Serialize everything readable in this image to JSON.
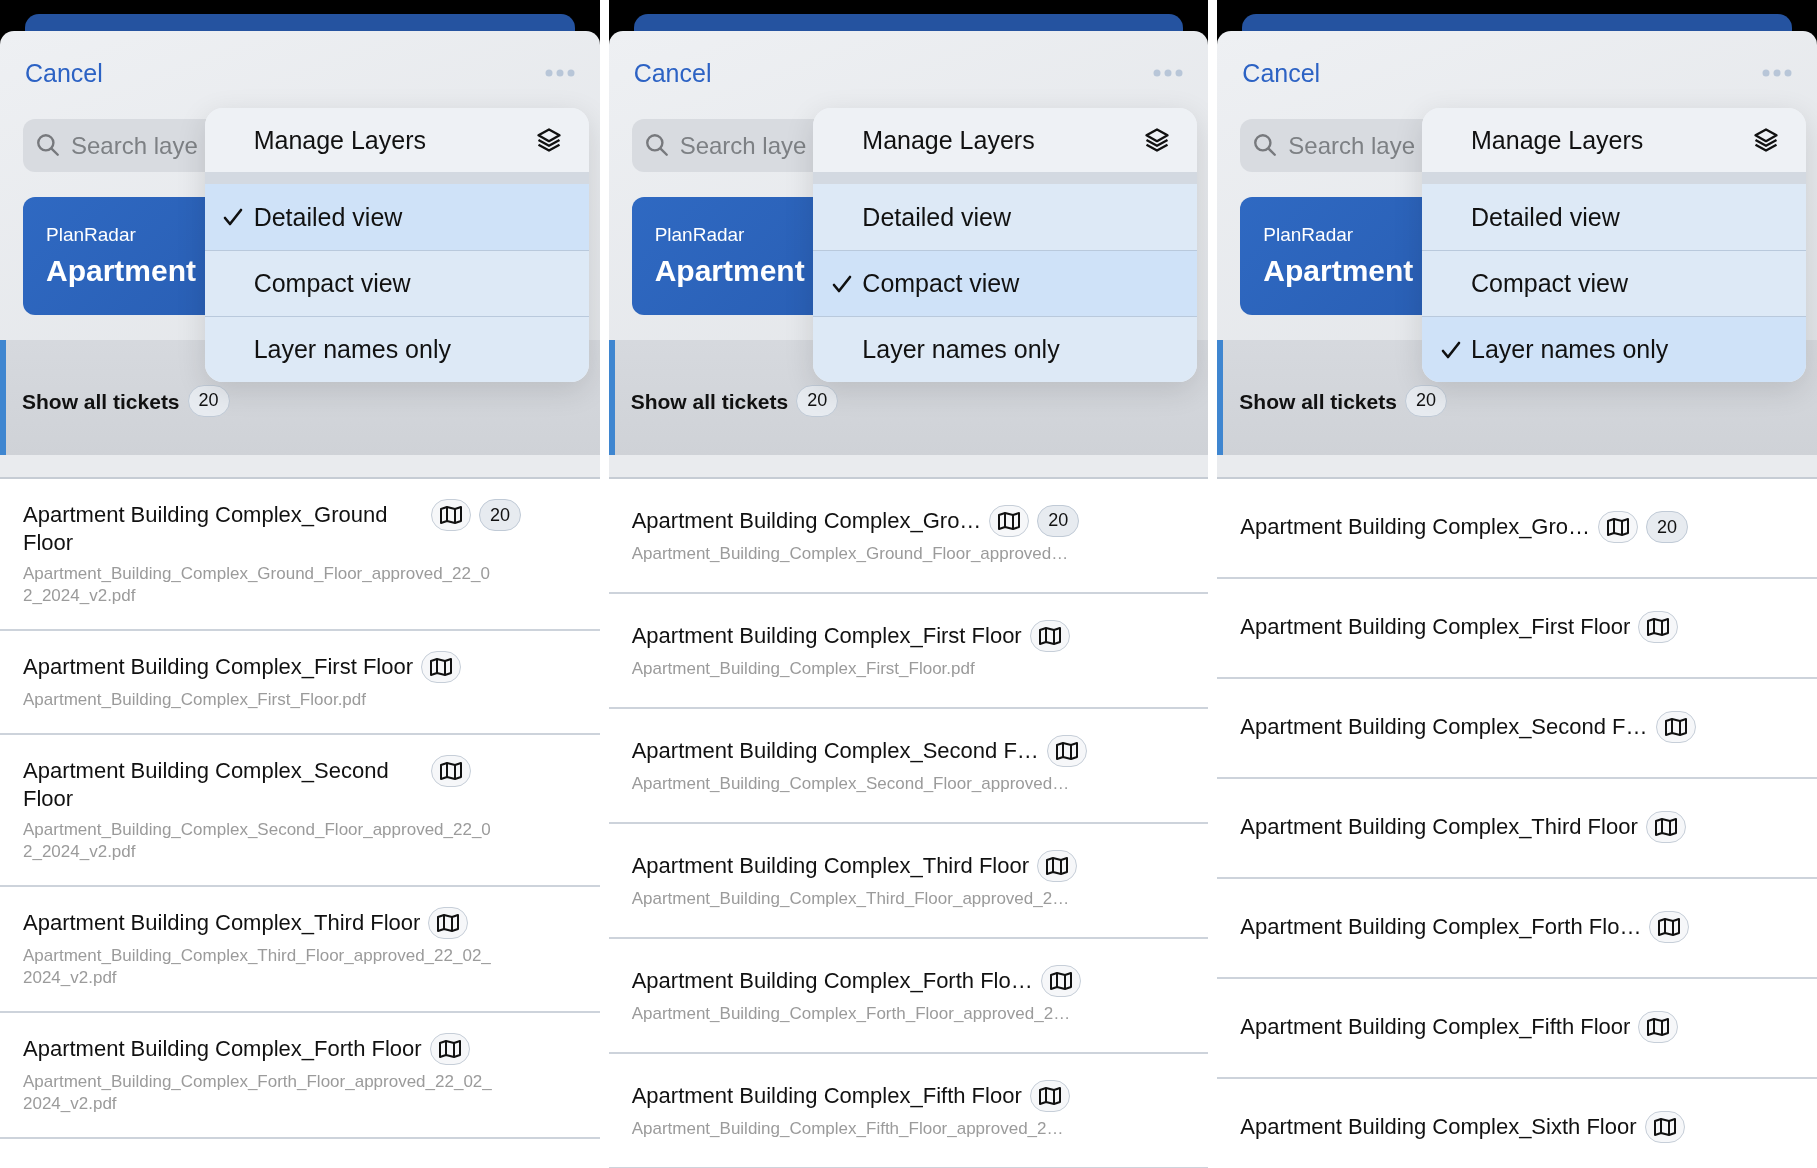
{
  "panels": [
    {
      "cancel": "Cancel",
      "search": {
        "placeholder": "Search laye"
      },
      "project": {
        "company": "PlanRadar",
        "name": "Apartment"
      },
      "tickets": {
        "label": "Show all tickets",
        "count": "20"
      },
      "menu": {
        "title": "Manage Layers",
        "options": [
          {
            "label": "Detailed view",
            "selected": true
          },
          {
            "label": "Compact view",
            "selected": false
          },
          {
            "label": "Layer names only",
            "selected": false
          }
        ]
      },
      "kind": "detailed",
      "layers": [
        {
          "title": "Apartment Building Complex_Ground Floor",
          "file": "Apartment_Building_Complex_Ground_Floor_approved_22_02_2024_v2.pdf",
          "count": "20"
        },
        {
          "title": "Apartment Building Complex_First Floor",
          "file": "Apartment_Building_Complex_First_Floor.pdf"
        },
        {
          "title": "Apartment Building Complex_Second Floor",
          "file": "Apartment_Building_Complex_Second_Floor_approved_22_02_2024_v2.pdf"
        },
        {
          "title": "Apartment Building Complex_Third Floor",
          "file": "Apartment_Building_Complex_Third_Floor_approved_22_02_2024_v2.pdf"
        },
        {
          "title": "Apartment Building Complex_Forth Floor",
          "file": "Apartment_Building_Complex_Forth_Floor_approved_22_02_2024_v2.pdf"
        }
      ]
    },
    {
      "cancel": "Cancel",
      "search": {
        "placeholder": "Search laye"
      },
      "project": {
        "company": "PlanRadar",
        "name": "Apartment"
      },
      "tickets": {
        "label": "Show all tickets",
        "count": "20"
      },
      "menu": {
        "title": "Manage Layers",
        "options": [
          {
            "label": "Detailed view",
            "selected": false
          },
          {
            "label": "Compact view",
            "selected": true
          },
          {
            "label": "Layer names only",
            "selected": false
          }
        ]
      },
      "kind": "compact",
      "layers": [
        {
          "title": "Apartment Building Complex_Gro…",
          "file": "Apartment_Building_Complex_Ground_Floor_approved…",
          "count": "20"
        },
        {
          "title": "Apartment Building Complex_First Floor",
          "file": "Apartment_Building_Complex_First_Floor.pdf"
        },
        {
          "title": "Apartment Building Complex_Second F…",
          "file": "Apartment_Building_Complex_Second_Floor_approved…"
        },
        {
          "title": "Apartment Building Complex_Third Floor",
          "file": "Apartment_Building_Complex_Third_Floor_approved_2…"
        },
        {
          "title": "Apartment Building Complex_Forth Flo…",
          "file": "Apartment_Building_Complex_Forth_Floor_approved_2…"
        },
        {
          "title": "Apartment Building Complex_Fifth Floor",
          "file": "Apartment_Building_Complex_Fifth_Floor_approved_2…"
        }
      ]
    },
    {
      "cancel": "Cancel",
      "search": {
        "placeholder": "Search laye"
      },
      "project": {
        "company": "PlanRadar",
        "name": "Apartment"
      },
      "tickets": {
        "label": "Show all tickets",
        "count": "20"
      },
      "menu": {
        "title": "Manage Layers",
        "options": [
          {
            "label": "Detailed view",
            "selected": false
          },
          {
            "label": "Compact view",
            "selected": false
          },
          {
            "label": "Layer names only",
            "selected": true
          }
        ]
      },
      "kind": "names",
      "layers": [
        {
          "title": "Apartment Building Complex_Gro…",
          "count": "20"
        },
        {
          "title": "Apartment Building Complex_First Floor"
        },
        {
          "title": "Apartment Building Complex_Second F…"
        },
        {
          "title": "Apartment Building Complex_Third Floor"
        },
        {
          "title": "Apartment Building Complex_Forth Flo…"
        },
        {
          "title": "Apartment Building Complex_Fifth Floor"
        },
        {
          "title": "Apartment Building Complex_Sixth Floor"
        }
      ]
    }
  ]
}
